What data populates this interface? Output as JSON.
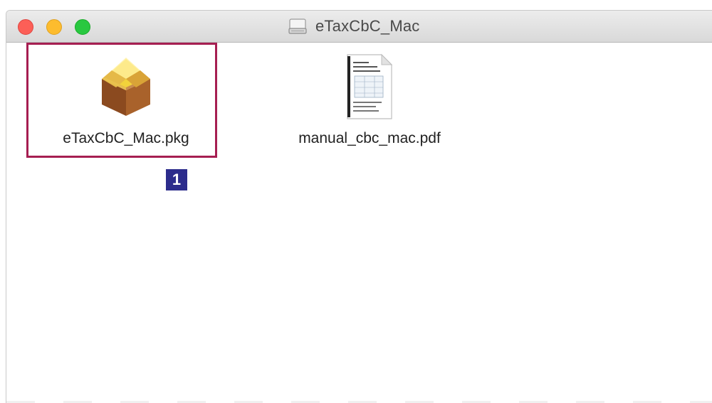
{
  "window": {
    "title": "eTaxCbC_Mac"
  },
  "files": [
    {
      "name": "eTaxCbC_Mac.pkg",
      "icon": "package-icon",
      "selected": true
    },
    {
      "name": "manual_cbc_mac.pdf",
      "icon": "pdf-document-icon",
      "selected": false
    }
  ],
  "annotation": {
    "step_number": "1",
    "highlight_color": "#a61e51",
    "badge_color": "#2c2c8c"
  },
  "traffic_lights": {
    "close": "#fc5f57",
    "minimize": "#fdbc2e",
    "zoom": "#29c840"
  }
}
